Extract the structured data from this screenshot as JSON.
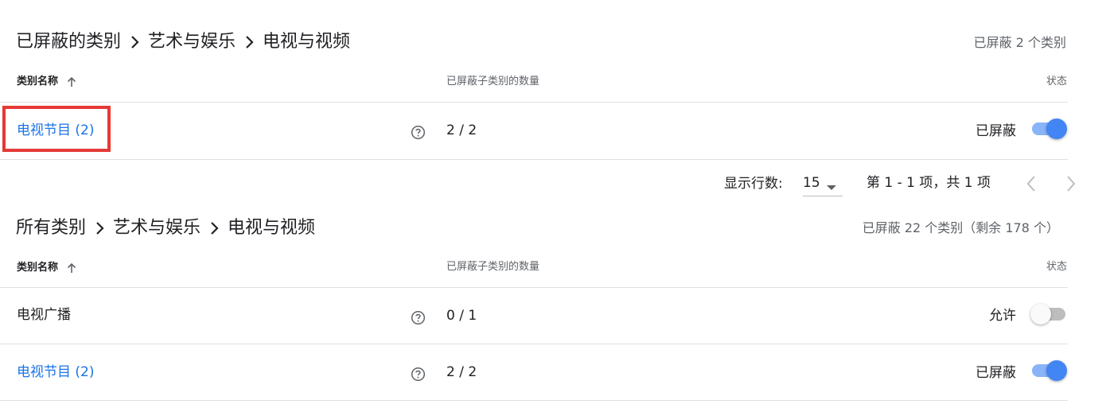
{
  "blocked_section": {
    "breadcrumb": [
      "已屏蔽的类别",
      "艺术与娱乐",
      "电视与视频"
    ],
    "summary": "已屏蔽 2 个类别",
    "columns": {
      "name": "类别名称",
      "count": "已屏蔽子类别的数量",
      "status": "状态"
    },
    "rows": [
      {
        "name": "电视节目 (2)",
        "count": "2 / 2",
        "status": "已屏蔽",
        "toggle_on": true,
        "is_link": true
      }
    ]
  },
  "pagination": {
    "rows_label": "显示行数:",
    "rows_value": "15",
    "range": "第 1 - 1 项，共 1 项"
  },
  "all_section": {
    "breadcrumb": [
      "所有类别",
      "艺术与娱乐",
      "电视与视频"
    ],
    "summary": "已屏蔽 22 个类别（剩余 178 个）",
    "columns": {
      "name": "类别名称",
      "count": "已屏蔽子类别的数量",
      "status": "状态"
    },
    "rows": [
      {
        "name": "电视广播",
        "count": "0 / 1",
        "status": "允许",
        "toggle_on": false,
        "is_link": false
      },
      {
        "name": "电视节目 (2)",
        "count": "2 / 2",
        "status": "已屏蔽",
        "toggle_on": true,
        "is_link": true
      }
    ]
  },
  "colors": {
    "link": "#1a73e8",
    "toggle_on_knob": "#4285f4",
    "toggle_on_track": "#8ab4f8",
    "toggle_off_track": "#bdbdbd",
    "highlight_border": "#e53935"
  },
  "icons": {
    "help": "help-circle-icon",
    "sort": "arrow-up-icon",
    "breadcrumb_separator": "chevron-right-icon",
    "dropdown": "caret-down-icon",
    "prev": "chevron-left-icon",
    "next": "chevron-right-icon"
  }
}
